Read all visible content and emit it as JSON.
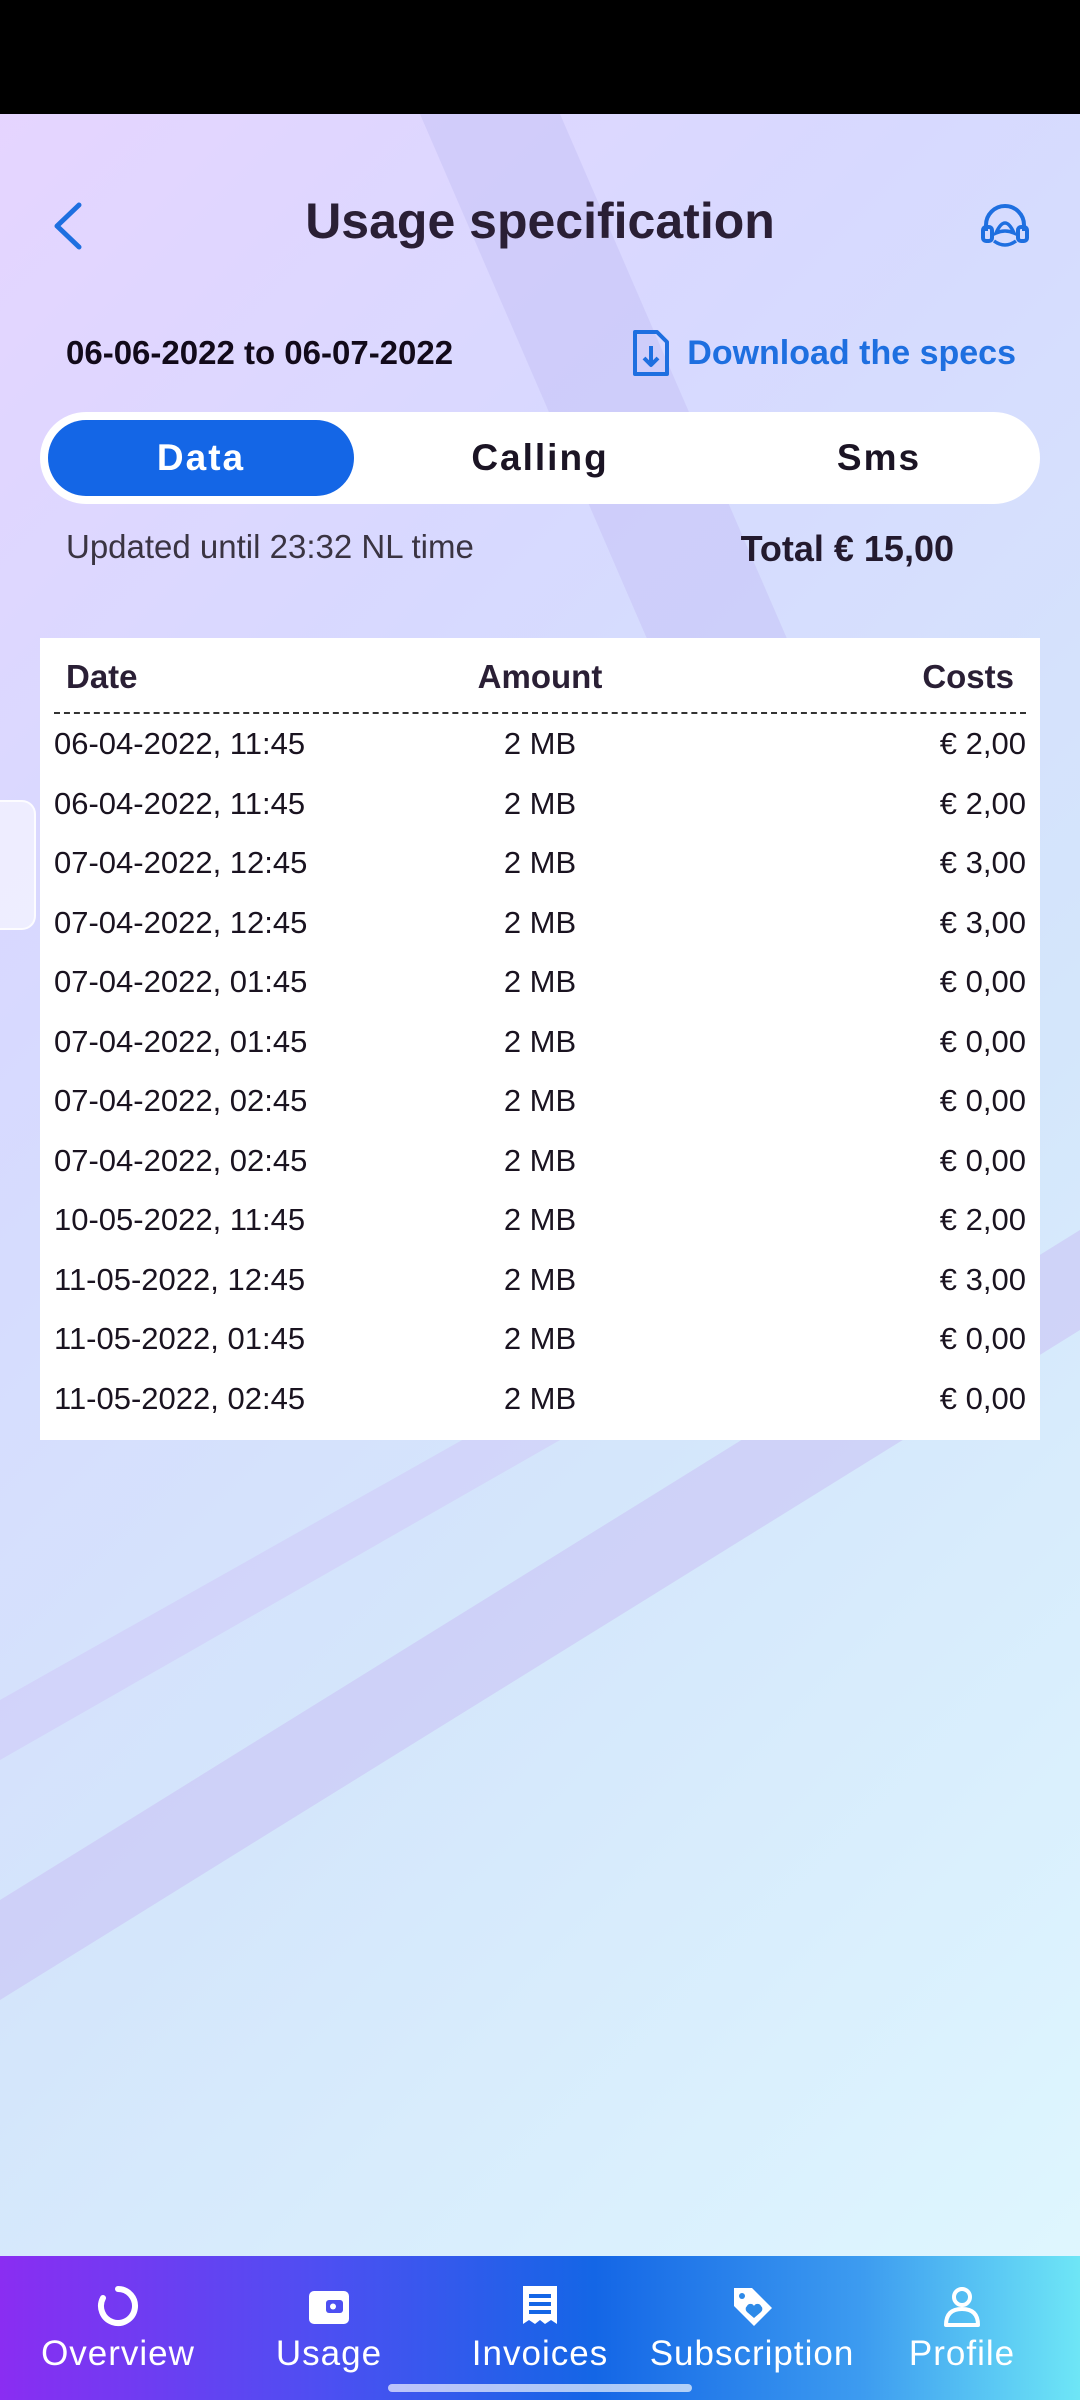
{
  "header": {
    "title": "Usage specification"
  },
  "period": {
    "text": "06-06-2022 to 06-07-2022",
    "download_label": "Download the specs"
  },
  "tabs": [
    {
      "label": "Data",
      "active": true
    },
    {
      "label": "Calling",
      "active": false
    },
    {
      "label": "Sms",
      "active": false
    }
  ],
  "summary": {
    "updated": "Updated until 23:32 NL time",
    "total": "Total € 15,00"
  },
  "table": {
    "headers": {
      "date": "Date",
      "amount": "Amount",
      "costs": "Costs"
    },
    "rows": [
      {
        "date": "06-04-2022, 11:45",
        "amount": "2 MB",
        "cost": "€ 2,00"
      },
      {
        "date": "06-04-2022, 11:45",
        "amount": "2 MB",
        "cost": "€ 2,00"
      },
      {
        "date": "07-04-2022, 12:45",
        "amount": "2 MB",
        "cost": "€ 3,00"
      },
      {
        "date": "07-04-2022, 12:45",
        "amount": "2 MB",
        "cost": "€ 3,00"
      },
      {
        "date": "07-04-2022, 01:45",
        "amount": "2 MB",
        "cost": "€ 0,00"
      },
      {
        "date": "07-04-2022, 01:45",
        "amount": "2 MB",
        "cost": "€ 0,00"
      },
      {
        "date": "07-04-2022, 02:45",
        "amount": "2 MB",
        "cost": "€ 0,00"
      },
      {
        "date": "07-04-2022, 02:45",
        "amount": "2 MB",
        "cost": "€ 0,00"
      },
      {
        "date": "10-05-2022, 11:45",
        "amount": "2 MB",
        "cost": "€ 2,00"
      },
      {
        "date": "11-05-2022, 12:45",
        "amount": "2 MB",
        "cost": "€ 3,00"
      },
      {
        "date": "11-05-2022, 01:45",
        "amount": "2 MB",
        "cost": "€ 0,00"
      },
      {
        "date": "11-05-2022, 02:45",
        "amount": "2 MB",
        "cost": "€ 0,00"
      }
    ]
  },
  "bottom_nav": [
    {
      "label": "Overview",
      "icon": "overview-ring-icon"
    },
    {
      "label": "Usage",
      "icon": "wallet-icon"
    },
    {
      "label": "Invoices",
      "icon": "receipt-icon"
    },
    {
      "label": "Subscription",
      "icon": "tag-heart-icon"
    },
    {
      "label": "Profile",
      "icon": "person-icon"
    }
  ],
  "colors": {
    "accent": "#1466e6",
    "link": "#1e6fe0",
    "nav_gradient_start": "#8a2df2",
    "nav_gradient_end": "#6ee6f6"
  }
}
